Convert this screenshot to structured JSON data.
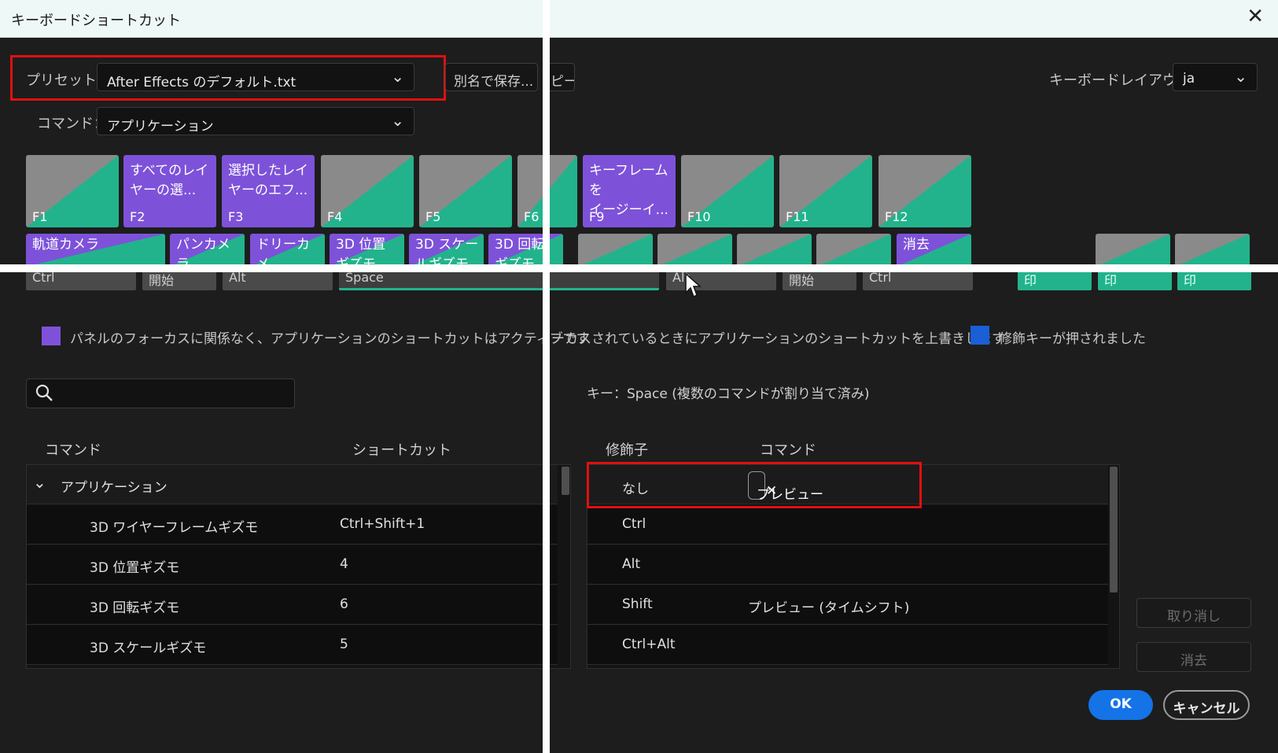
{
  "window": {
    "title": "キーボードショートカット",
    "close_glyph": "✕"
  },
  "preset": {
    "label": "プリセット：",
    "value": "After Effects のデフォルト.txt",
    "save_as": "別名で保存...",
    "copy_fragment": "ピー"
  },
  "command": {
    "label": "コマンド：",
    "value": "アプリケーション"
  },
  "layout": {
    "label": "キーボードレイアウト：",
    "value": "ja"
  },
  "fkeys": [
    {
      "name": "F1",
      "cmd": ""
    },
    {
      "name": "F2",
      "cmd": "すべてのレイ\nヤーの選..."
    },
    {
      "name": "F3",
      "cmd": "選択したレイ\nヤーのエフ..."
    },
    {
      "name": "F4",
      "cmd": ""
    },
    {
      "name": "F5",
      "cmd": ""
    },
    {
      "name": "F6",
      "cmd": ""
    },
    {
      "name": "F9",
      "cmd": "キーフレームを\nイージーイ..."
    },
    {
      "name": "F10",
      "cmd": ""
    },
    {
      "name": "F11",
      "cmd": ""
    },
    {
      "name": "F12",
      "cmd": ""
    }
  ],
  "numrow": [
    {
      "cmd": "軌道カメラ"
    },
    {
      "cmd": "パンカメラ"
    },
    {
      "cmd": "ドリーカメ\nラ"
    },
    {
      "cmd": "3D 位置\nギズモ"
    },
    {
      "cmd": "3D スケー\nルギズモ"
    },
    {
      "cmd": "3D 回転\nギズモ"
    },
    {
      "cmd": ""
    },
    {
      "cmd": ""
    },
    {
      "cmd": ""
    },
    {
      "cmd": ""
    },
    {
      "cmd": "消去"
    },
    {
      "cmd": ""
    },
    {
      "cmd": ""
    }
  ],
  "bottomrow": {
    "ctrl": "Ctrl",
    "start": "開始",
    "alt": "Alt",
    "space": "Space",
    "alt2": "Alt",
    "start2": "開始",
    "ctrl2": "Ctrl",
    "numpad": [
      "印",
      "印",
      "印"
    ]
  },
  "legend": {
    "app_text": "パネルのフォーカスに関係なく、アプリケーションのショートカットはアクティブです",
    "panel_text": "ーカスされているときにアプリケーションのショートカットを上書きします",
    "modifier_text": "修飾キーが押されました",
    "colors": {
      "app": "#7d52d9",
      "panel": "#22b38c",
      "modifier": "#1a5fd6"
    }
  },
  "search": {
    "placeholder": "",
    "icon": "search-icon"
  },
  "commands_table": {
    "headers": [
      "コマンド",
      "ショートカット"
    ],
    "group": "アプリケーション",
    "rows": [
      {
        "command": "3D ワイヤーフレームギズモ",
        "shortcut": "Ctrl+Shift+1"
      },
      {
        "command": "3D 位置ギズモ",
        "shortcut": "4"
      },
      {
        "command": "3D 回転ギズモ",
        "shortcut": "6"
      },
      {
        "command": "3D スケールギズモ",
        "shortcut": "5"
      }
    ]
  },
  "key_info": "キー：Space (複数のコマンドが割り当て済み)",
  "modifier_table": {
    "headers": [
      "修飾子",
      "コマンド"
    ],
    "rows": [
      {
        "modifier": "なし",
        "command": "プレビュー"
      },
      {
        "modifier": "Ctrl",
        "command": ""
      },
      {
        "modifier": "Alt",
        "command": ""
      },
      {
        "modifier": "Shift",
        "command": "プレビュー (タイムシフト)"
      },
      {
        "modifier": "Ctrl+Alt",
        "command": ""
      }
    ],
    "chip_close": "✕"
  },
  "buttons": {
    "undo": "取り消し",
    "clear": "消去",
    "ok": "OK",
    "cancel": "キャンセル"
  }
}
